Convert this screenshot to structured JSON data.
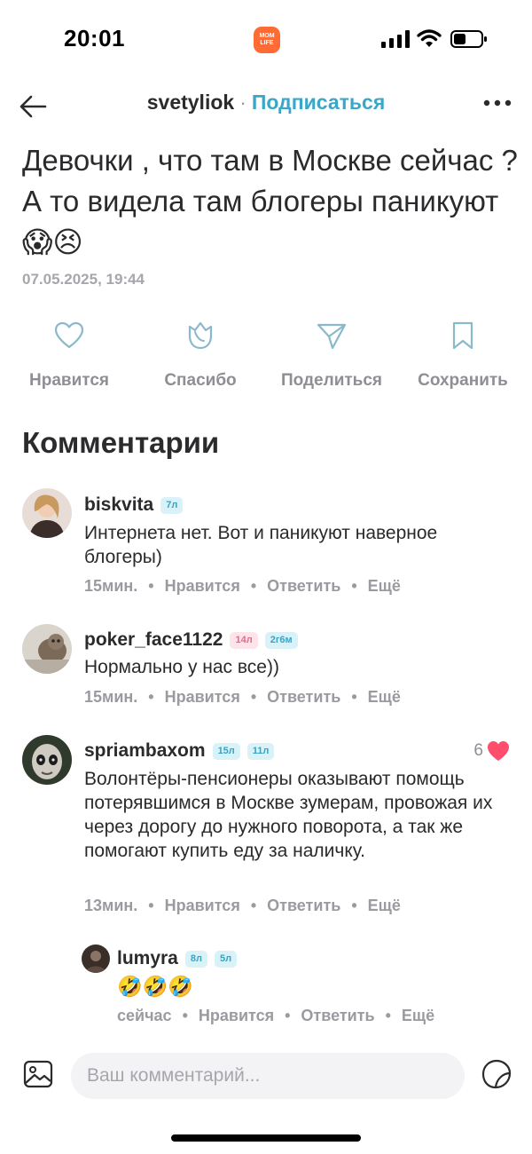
{
  "status_bar": {
    "time": "20:01",
    "app_badge": "MOM LIFE"
  },
  "header": {
    "author": "svetyliok",
    "separator": "·",
    "subscribe": "Подписаться"
  },
  "post": {
    "text": "Девочки , что там в Москве сейчас ? А то видела там блогеры паникуют 😱😣",
    "date": "07.05.2025, 19:44"
  },
  "actions": {
    "like": "Нравится",
    "thanks": "Спасибо",
    "share": "Поделиться",
    "save": "Сохранить"
  },
  "comments_title": "Комментарии",
  "meta_labels": {
    "like": "Нравится",
    "reply": "Ответить",
    "more": "Ещё",
    "sep": "•"
  },
  "comments": [
    {
      "user": "biskvita",
      "tags": [
        "7л"
      ],
      "text": "Интернета нет. Вот и паникуют наверное блогеры)",
      "time": "15мин."
    },
    {
      "user": "poker_face1122",
      "tags": [
        "14л",
        "2г6м"
      ],
      "text": "Нормально у нас все))",
      "time": "15мин."
    },
    {
      "user": "spriambaxom",
      "tags": [
        "15л",
        "11л"
      ],
      "text": "Волонтёры-пенсионеры оказывают помощь потерявшимся в Москве зумерам, провожая их через дорогу до нужного поворота, а так же помогают купить еду за наличку.",
      "time": "13мин.",
      "likes": "6"
    },
    {
      "user": "lumyra",
      "tags": [
        "8л",
        "5л"
      ],
      "text": "🤣🤣🤣",
      "time": "сейчас"
    }
  ],
  "input": {
    "placeholder": "Ваш комментарий..."
  },
  "colors": {
    "accent": "#3ba7c8",
    "heart": "#ff4d6d",
    "badge": "#ff6b35"
  }
}
